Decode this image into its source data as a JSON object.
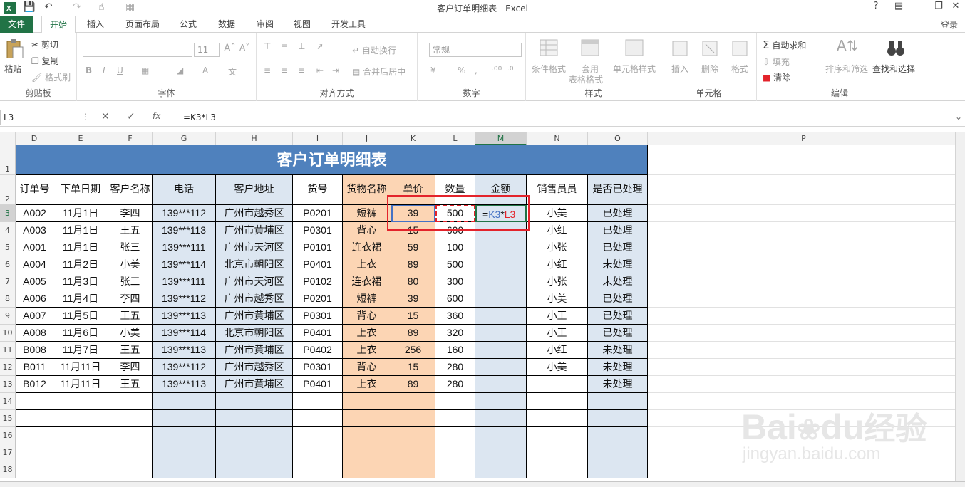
{
  "app": {
    "title": "客户订单明细表 - Excel",
    "login": "登录",
    "help": "?"
  },
  "tabs": [
    "文件",
    "开始",
    "插入",
    "页面布局",
    "公式",
    "数据",
    "审阅",
    "视图",
    "开发工具"
  ],
  "ribbon": {
    "clipboard": {
      "paste": "粘贴",
      "cut": "剪切",
      "copy": "复制",
      "painter": "格式刷",
      "label": "剪贴板"
    },
    "font": {
      "size": "11",
      "label": "字体"
    },
    "align": {
      "wrap": "自动换行",
      "merge": "合并后居中",
      "label": "对齐方式"
    },
    "number": {
      "format": "常规",
      "label": "数字"
    },
    "styles": {
      "cond": "条件格式",
      "table": "套用",
      "table2": "表格格式",
      "cellstyle": "单元格样式",
      "label": "样式"
    },
    "cells": {
      "insert": "插入",
      "delete": "删除",
      "format": "格式",
      "label": "单元格"
    },
    "editing": {
      "autosum": "自动求和",
      "fill": "填充",
      "clear": "清除",
      "sort": "排序和筛选",
      "find": "查找和选择",
      "label": "编辑"
    }
  },
  "formula_bar": {
    "name_box": "L3",
    "formula": "=K3*L3"
  },
  "columns": [
    "D",
    "E",
    "F",
    "G",
    "H",
    "I",
    "J",
    "K",
    "L",
    "M",
    "N",
    "O",
    "P"
  ],
  "rows": [
    "1",
    "2",
    "3",
    "4",
    "5",
    "6",
    "7",
    "8",
    "9",
    "10",
    "11",
    "12",
    "13",
    "14",
    "15",
    "16",
    "17",
    "18"
  ],
  "sheet_title": "客户订单明细表",
  "headers": [
    "订单号",
    "下单日期",
    "客户名称",
    "电话",
    "客户地址",
    "货号",
    "货物名称",
    "单价",
    "数量",
    "金额",
    "销售员员",
    "是否已处理"
  ],
  "data_rows": [
    [
      "A002",
      "11月1日",
      "李四",
      "139***112",
      "广州市越秀区",
      "P0201",
      "短裤",
      "39",
      "500",
      "",
      "小美",
      "已处理"
    ],
    [
      "A003",
      "11月1日",
      "王五",
      "139***113",
      "广州市黄埔区",
      "P0301",
      "背心",
      "15",
      "600",
      "",
      "小红",
      "已处理"
    ],
    [
      "A001",
      "11月1日",
      "张三",
      "139***111",
      "广州市天河区",
      "P0101",
      "连衣裙",
      "59",
      "100",
      "",
      "小张",
      "已处理"
    ],
    [
      "A004",
      "11月2日",
      "小美",
      "139***114",
      "北京市朝阳区",
      "P0401",
      "上衣",
      "89",
      "500",
      "",
      "小红",
      "未处理"
    ],
    [
      "A005",
      "11月3日",
      "张三",
      "139***111",
      "广州市天河区",
      "P0102",
      "连衣裙",
      "80",
      "300",
      "",
      "小张",
      "未处理"
    ],
    [
      "A006",
      "11月4日",
      "李四",
      "139***112",
      "广州市越秀区",
      "P0201",
      "短裤",
      "39",
      "600",
      "",
      "小美",
      "已处理"
    ],
    [
      "A007",
      "11月5日",
      "王五",
      "139***113",
      "广州市黄埔区",
      "P0301",
      "背心",
      "15",
      "360",
      "",
      "小王",
      "已处理"
    ],
    [
      "A008",
      "11月6日",
      "小美",
      "139***114",
      "北京市朝阳区",
      "P0401",
      "上衣",
      "89",
      "320",
      "",
      "小王",
      "已处理"
    ],
    [
      "B008",
      "11月7日",
      "王五",
      "139***113",
      "广州市黄埔区",
      "P0402",
      "上衣",
      "256",
      "160",
      "",
      "小红",
      "未处理"
    ],
    [
      "B011",
      "11月11日",
      "李四",
      "139***112",
      "广州市越秀区",
      "P0301",
      "背心",
      "15",
      "280",
      "",
      "小美",
      "未处理"
    ],
    [
      "B012",
      "11月11日",
      "王五",
      "139***113",
      "广州市黄埔区",
      "P0401",
      "上衣",
      "89",
      "280",
      "",
      "",
      "未处理"
    ]
  ],
  "edit_cell": {
    "eq": "=",
    "ref1": "K3",
    "op": "*",
    "ref2": "L3"
  },
  "colors": {
    "title_bg": "#4f81bd",
    "blue_col": "#dce6f1",
    "orange_col": "#fcd5b4",
    "excel_green": "#217346",
    "ref1": "#4472c4",
    "ref2": "#e3232b"
  },
  "watermark": {
    "brand": "Bai",
    "brand2": "du",
    "brand_cn": "经验",
    "url": "jingyan.baidu.com"
  }
}
